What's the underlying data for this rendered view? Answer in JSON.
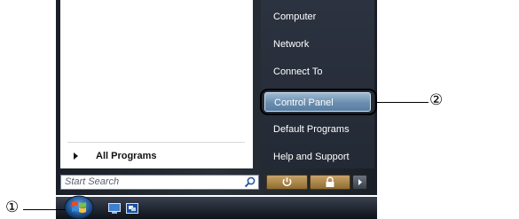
{
  "start_menu": {
    "right_items": [
      "Computer",
      "Network",
      "Connect To",
      "Control Panel",
      "Default Programs",
      "Help and Support"
    ],
    "highlighted_item": "Control Panel",
    "all_programs_label": "All Programs",
    "search_placeholder": "Start Search"
  },
  "callouts": {
    "start_button_marker": "①",
    "control_panel_marker": "②"
  },
  "icons": {
    "search": "magnifier-icon",
    "power": "power-icon",
    "lock": "lock-icon",
    "more": "arrow-right-icon",
    "start": "windows-logo-icon",
    "show_desktop": "show-desktop-icon",
    "switch_windows": "switch-windows-icon"
  },
  "colors": {
    "highlight": "#7a9ab9",
    "power_buttons": "#b08a4a",
    "taskbar": "#1a1f27"
  }
}
